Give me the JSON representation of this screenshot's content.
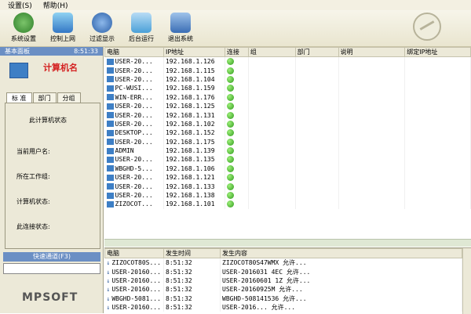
{
  "menu": [
    "设置(S)",
    "帮助(H)"
  ],
  "toolbar": [
    "系统设置",
    "控制上网",
    "过滤显示",
    "后台运行",
    "退出系统"
  ],
  "left_panel": {
    "title": "基本面板",
    "time": "8:51:33",
    "computer_name_label": "计算机名",
    "tabs": [
      "标 准",
      "部门",
      "分组"
    ],
    "state_title": "此计算机状态",
    "fields": [
      "当前用户名:",
      "所在工作组:",
      "计算机状态:",
      "此连接状态:"
    ],
    "quick_title": "快速通道(F3)",
    "brand": "MPSOFT"
  },
  "table": {
    "headers": [
      "电脑",
      "IP地址",
      "连接",
      "组",
      "部门",
      "说明",
      "绑定IP地址"
    ],
    "rows": [
      [
        "USER-20...",
        "192.168.1.126"
      ],
      [
        "USER-20...",
        "192.168.1.115"
      ],
      [
        "USER-20...",
        "192.168.1.104"
      ],
      [
        "PC-WUSI...",
        "192.168.1.159"
      ],
      [
        "WIN-ERR...",
        "192.168.1.176"
      ],
      [
        "USER-20...",
        "192.168.1.125"
      ],
      [
        "USER-20...",
        "192.168.1.131"
      ],
      [
        "USER-20...",
        "192.168.1.102"
      ],
      [
        "DESKTOP...",
        "192.168.1.152"
      ],
      [
        "USER-20...",
        "192.168.1.175"
      ],
      [
        "ADMIN",
        "192.168.1.139"
      ],
      [
        "USER-20...",
        "192.168.1.135"
      ],
      [
        "WBGHD-5...",
        "192.168.1.106"
      ],
      [
        "USER-20...",
        "192.168.1.121"
      ],
      [
        "USER-20...",
        "192.168.1.133"
      ],
      [
        "USER-20...",
        "192.168.1.138"
      ],
      [
        "ZIZOCOT...",
        "192.168.1.101"
      ]
    ]
  },
  "messages": {
    "headers": [
      "电脑",
      "发生时间",
      "发生内容"
    ],
    "rows": [
      [
        "ZIZOCOT80S...",
        "8:51:32",
        "ZIZOCOT80S47WMX 允许..."
      ],
      [
        "USER-20160...",
        "8:51:32",
        "USER-2016031 4EC 允许..."
      ],
      [
        "USER-20160...",
        "8:51:32",
        "USER-20160601 1Z 允许..."
      ],
      [
        "USER-20160...",
        "8:51:32",
        "USER-20160925M 允许..."
      ],
      [
        "WBGHD-5081...",
        "8:51:32",
        "WBGHD-508141536 允许..."
      ],
      [
        "USER-20160...",
        "8:51:32",
        "USER-2016... 允许..."
      ]
    ]
  }
}
